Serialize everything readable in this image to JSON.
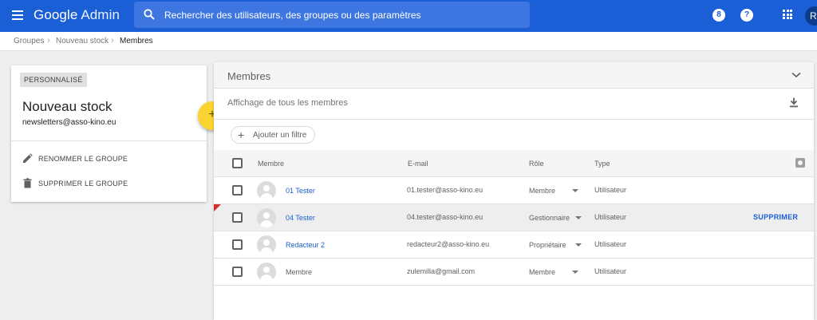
{
  "header": {
    "brand_google": "Google",
    "brand_admin": "Admin",
    "search_placeholder": "Rechercher des utilisateurs, des groupes ou des paramètres",
    "help_badge": "8",
    "help_icon": "?",
    "avatar_initial": "R",
    "colors": {
      "bar": "#1a5fd6",
      "search": "#3d76e0"
    }
  },
  "breadcrumb": [
    "Groupes",
    "Nouveau stock",
    "Membres"
  ],
  "group": {
    "tag": "PERSONNALISÉ",
    "name": "Nouveau stock",
    "email": "newsletters@asso-kino.eu",
    "actions": [
      "RENOMMER LE GROUPE",
      "SUPPRIMER LE GROUPE"
    ],
    "fab_label": "+",
    "fab_color": "#fbd331"
  },
  "members": {
    "title": "Membres",
    "subtitle": "Affichage de tous les membres",
    "filter_label": "Ajouter un filtre",
    "columns": [
      "Membre",
      "E-mail",
      "Rôle",
      "Type"
    ],
    "rows": [
      {
        "name": "01 Tester",
        "email": "01.tester@asso-kino.eu",
        "role": "Membre",
        "type": "Utilisateur",
        "link": true
      },
      {
        "name": "04 Tester",
        "email": "04.tester@asso-kino.eu",
        "role": "Gestionnaire",
        "type": "Utilisateur",
        "link": true,
        "action": "SUPPRIMER"
      },
      {
        "name": "Redacteur 2",
        "email": "redacteur2@asso-kino.eu",
        "role": "Propriétaire",
        "type": "Utilisateur",
        "link": true
      },
      {
        "name": "Membre",
        "email": "zulemilla@gmail.com",
        "role": "Membre",
        "type": "Utilisateur",
        "link": false
      }
    ]
  }
}
